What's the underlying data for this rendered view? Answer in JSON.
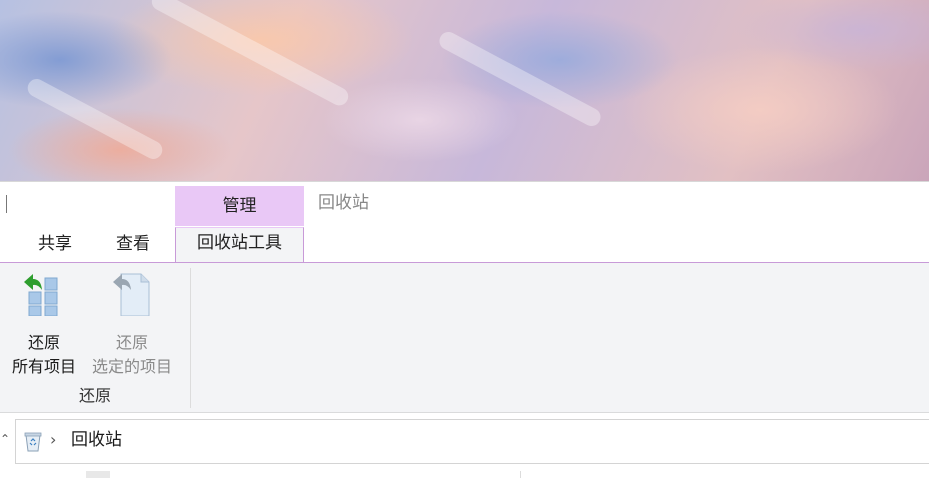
{
  "window": {
    "title": "回收站",
    "context_group": "管理"
  },
  "tabs": [
    {
      "label": "共享",
      "active": false
    },
    {
      "label": "查看",
      "active": false
    },
    {
      "label": "回收站工具",
      "active": true
    }
  ],
  "ribbon": {
    "restore_all": {
      "line1": "还原",
      "line2": "所有项目",
      "icon": "restore-all-icon"
    },
    "restore_selected": {
      "line1": "还原",
      "line2": "选定的项目",
      "icon": "restore-selected-icon"
    },
    "group_label": "还原"
  },
  "address_bar": {
    "icon": "recycle-bin-icon",
    "path": "回收站"
  },
  "colors": {
    "context_tab": "#e9c8f6",
    "ribbon_bg": "#f3f4f6",
    "restore_arrow": "#2e9e2e"
  }
}
